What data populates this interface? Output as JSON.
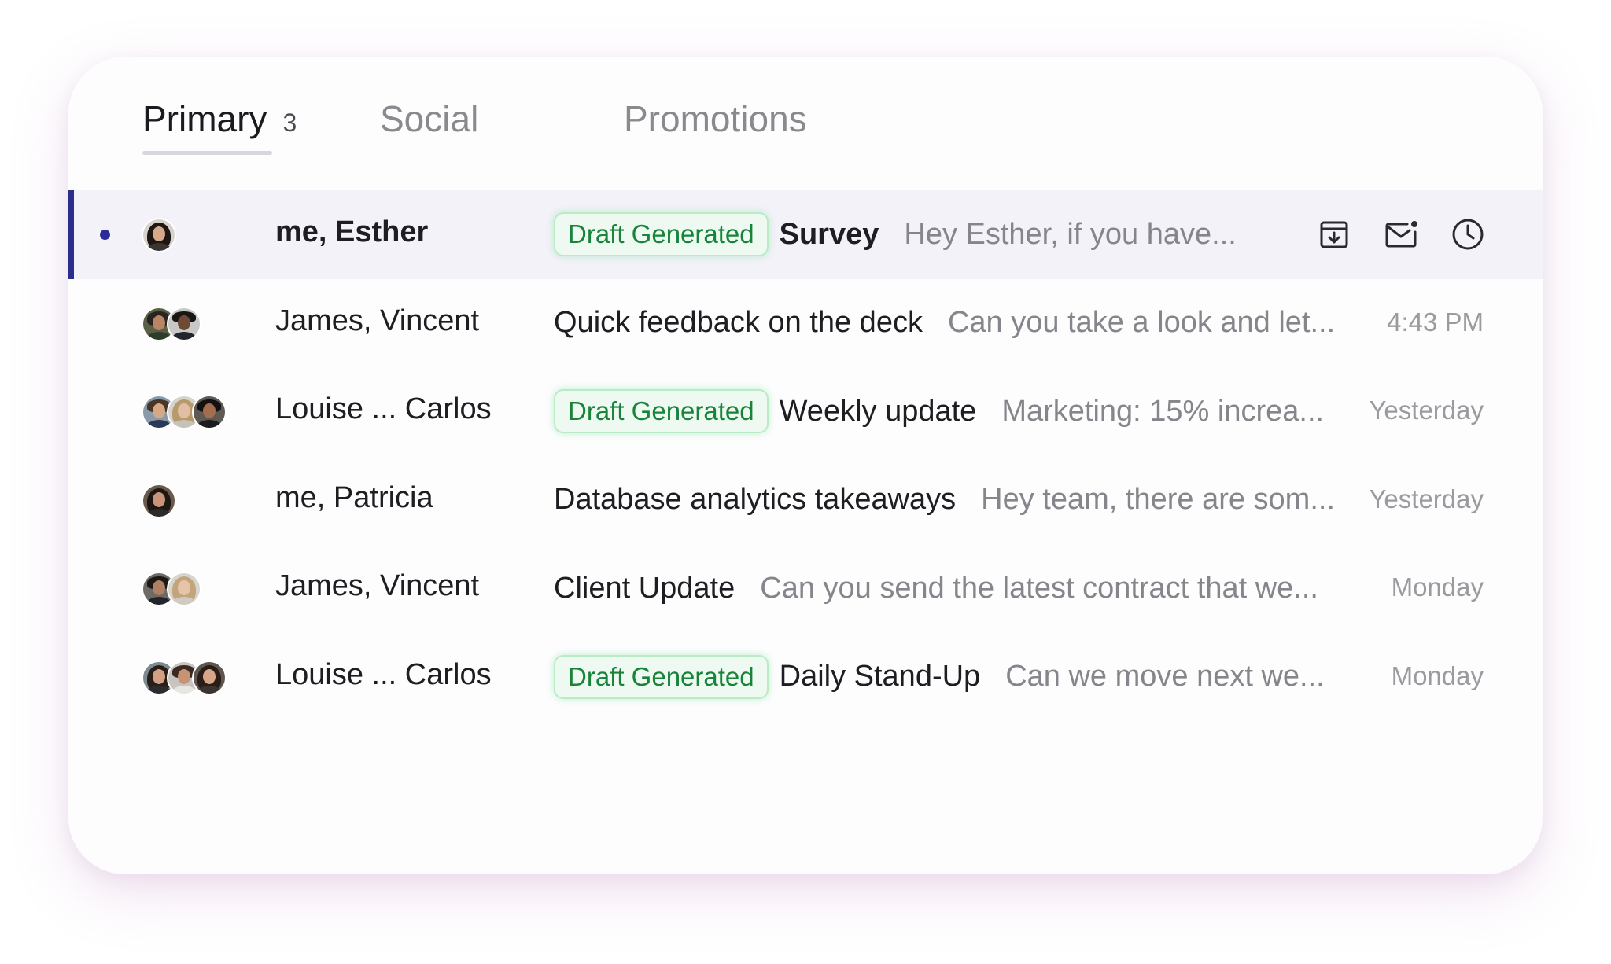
{
  "tabs": [
    {
      "label": "Primary",
      "count": "3",
      "active": true
    },
    {
      "label": "Social",
      "active": false
    },
    {
      "label": "Promotions",
      "active": false
    }
  ],
  "colors": {
    "accent": "#2b2c8c",
    "badge_text": "#17843a",
    "badge_bg": "#eefaf1",
    "selected_row_bg": "#f3f2f8"
  },
  "row_actions": [
    "archive-icon",
    "mark-unread-icon",
    "snooze-clock-icon"
  ],
  "emails": [
    {
      "sender": "me, Esther",
      "badge": "Draft Generated",
      "subject": "Survey",
      "snippet": "Hey Esther, if you have...",
      "time": "",
      "selected": true,
      "unread": true,
      "avatar_count": 1
    },
    {
      "sender": "James, Vincent",
      "badge": "",
      "subject": "Quick feedback on the deck",
      "snippet": "Can you take a look and let...",
      "time": "4:43 PM",
      "avatar_count": 2
    },
    {
      "sender": "Louise ... Carlos",
      "badge": "Draft Generated",
      "subject": "Weekly update",
      "snippet": "Marketing: 15% increa...",
      "time": "Yesterday",
      "avatar_count": 3
    },
    {
      "sender": "me, Patricia",
      "badge": "",
      "subject": "Database analytics takeaways",
      "snippet": "Hey team, there are som...",
      "time": "Yesterday",
      "avatar_count": 1
    },
    {
      "sender": "James, Vincent",
      "badge": "",
      "subject": "Client Update",
      "snippet": "Can you send the latest contract that we...",
      "time": "Monday",
      "avatar_count": 2
    },
    {
      "sender": "Louise ... Carlos",
      "badge": "Draft Generated",
      "subject": "Daily Stand-Up",
      "snippet": "Can we move next we...",
      "time": "Monday",
      "avatar_count": 3
    }
  ]
}
